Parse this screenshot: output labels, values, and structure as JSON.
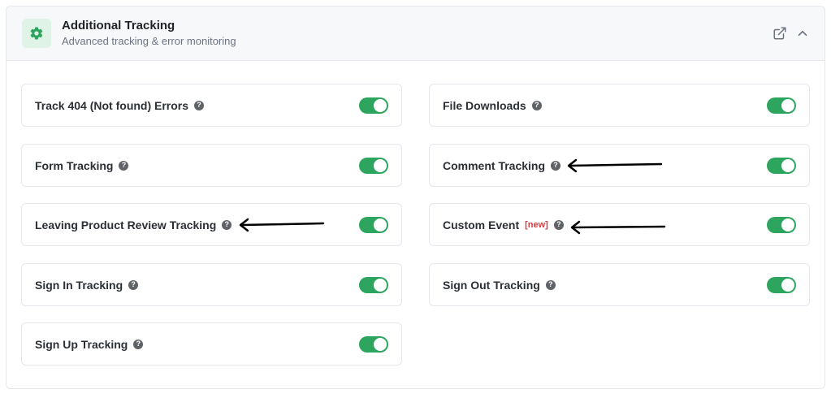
{
  "header": {
    "title": "Additional Tracking",
    "subtitle": "Advanced tracking & error monitoring",
    "icon": "gear-icon",
    "actions": [
      "external-link-icon",
      "chevron-up-icon"
    ]
  },
  "colors": {
    "accent": "#2ea55e",
    "icon_bg": "#dff3e6",
    "new_badge": "#e0353b"
  },
  "settings": [
    {
      "label": "Track 404 (Not found) Errors",
      "enabled": true
    },
    {
      "label": "File Downloads",
      "enabled": true
    },
    {
      "label": "Form Tracking",
      "enabled": true
    },
    {
      "label": "Comment Tracking",
      "enabled": true
    },
    {
      "label": "Leaving Product Review Tracking",
      "enabled": true
    },
    {
      "label": "Custom Event",
      "badge": "[new]",
      "enabled": true
    },
    {
      "label": "Sign In Tracking",
      "enabled": true
    },
    {
      "label": "Sign Out Tracking",
      "enabled": true
    },
    {
      "label": "Sign Up Tracking",
      "enabled": true
    }
  ],
  "help_glyph": "?"
}
